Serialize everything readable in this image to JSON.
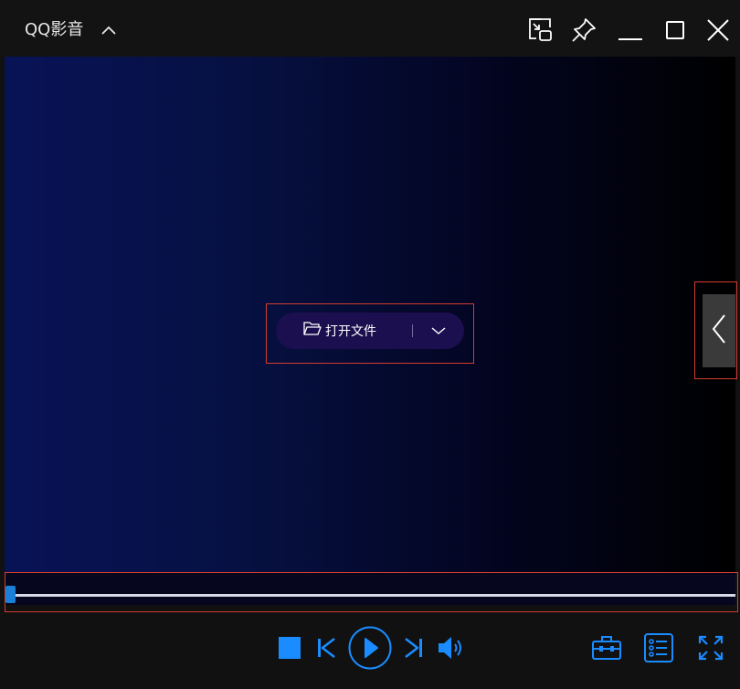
{
  "window": {
    "title": "QQ影音",
    "icons": [
      "chevron-up-icon",
      "mini-mode-icon",
      "pin-icon",
      "minimize-icon",
      "maximize-icon",
      "close-icon"
    ]
  },
  "player": {
    "open_file_label": "打开文件",
    "open_icon": "folder-open-icon",
    "dropdown_icon": "chevron-down-icon",
    "side_panel_icon": "chevron-left-icon",
    "progress": 0.0
  },
  "controls": {
    "icons": [
      "stop-icon",
      "previous-icon",
      "play-icon",
      "next-icon",
      "volume-icon",
      "toolbox-icon",
      "playlist-icon",
      "fullscreen-icon"
    ]
  },
  "colors": {
    "accent": "#1a8cff",
    "highlight_box": "#d23b30",
    "video_left": "#081357",
    "video_right": "#000000",
    "open_button_bg": "#1c0f4f"
  }
}
